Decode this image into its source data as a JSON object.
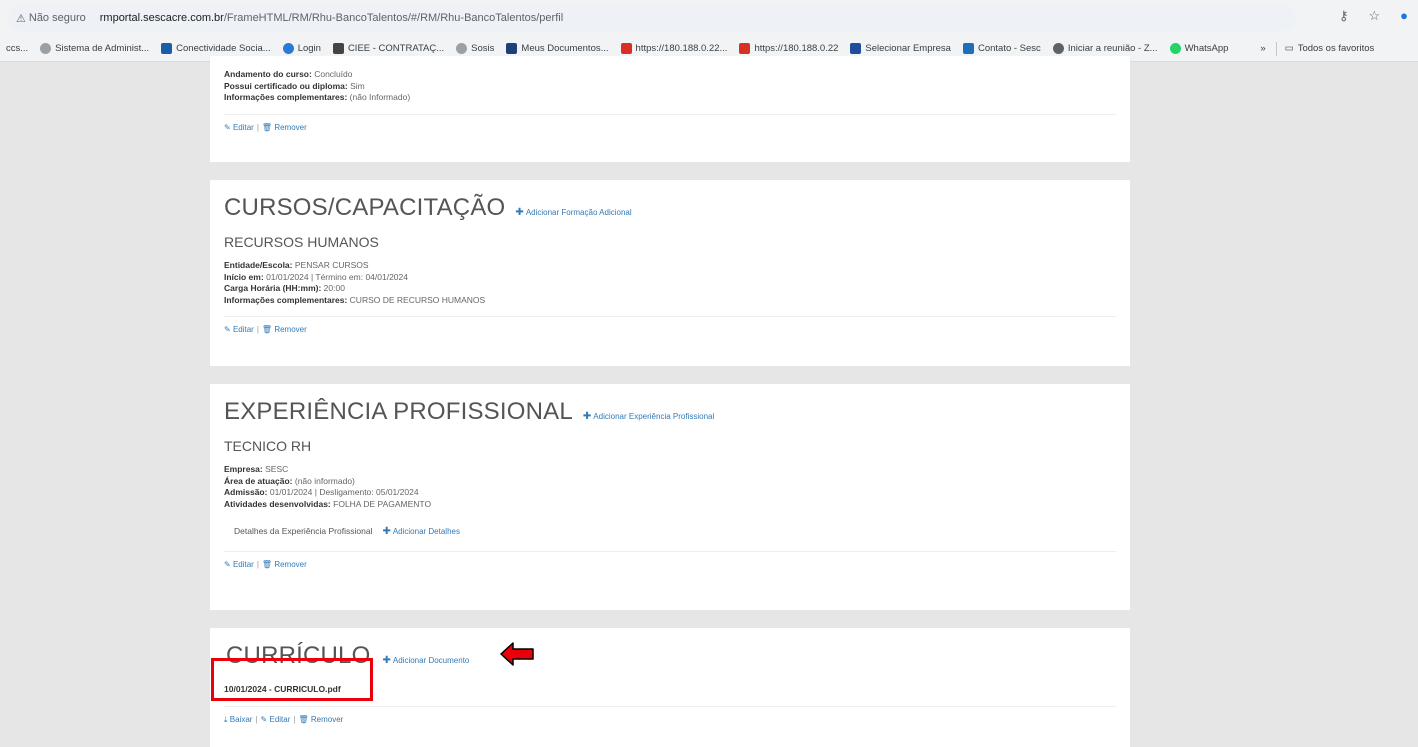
{
  "browser": {
    "not_secure": "Não seguro",
    "url_host": "rmportal.sescacre.com.br",
    "url_path": "/FrameHTML/RM/Rhu-BancoTalentos/#/RM/Rhu-BancoTalentos/perfil",
    "bookmarks": [
      {
        "label": "Sistema de Administ..."
      },
      {
        "label": "Conectividade Socia..."
      },
      {
        "label": "Login"
      },
      {
        "label": "CIEE - CONTRATAÇ..."
      },
      {
        "label": "Sosis"
      },
      {
        "label": "Meus Documentos..."
      },
      {
        "label": "https://180.188.0.22..."
      },
      {
        "label": "https://180.188.0.22"
      },
      {
        "label": "Selecionar Empresa"
      },
      {
        "label": "Contato - Sesc"
      },
      {
        "label": "Iniciar a reunião - Z..."
      },
      {
        "label": "WhatsApp"
      }
    ],
    "bookmarks_prefix": "ccs...",
    "more": "»",
    "all_favorites": "Todos os favoritos"
  },
  "top_card": {
    "fields": [
      {
        "label": "Andamento do curso:",
        "value": "Concluído"
      },
      {
        "label": "Possui certificado ou diploma:",
        "value": "Sim"
      },
      {
        "label": "Informações complementares:",
        "value": "(não Informado)"
      }
    ],
    "edit": "Editar",
    "remove": "Remover"
  },
  "courses": {
    "title": "CURSOS/CAPACITAÇÃO",
    "add_label": "Adicionar Formação Adicional",
    "item_title": "RECURSOS HUMANOS",
    "fields": [
      {
        "label": "Entidade/Escola:",
        "value": "PENSAR CURSOS"
      },
      {
        "label": "Início em:",
        "value": "01/01/2024 | Término em: 04/01/2024"
      },
      {
        "label": "Carga Horária (HH:mm):",
        "value": "20:00"
      },
      {
        "label": "Informações complementares:",
        "value": "CURSO DE RECURSO HUMANOS"
      }
    ],
    "edit": "Editar",
    "remove": "Remover"
  },
  "experience": {
    "title": "EXPERIÊNCIA PROFISSIONAL",
    "add_label": "Adicionar Experiência Profissional",
    "item_title": "TECNICO RH",
    "fields": [
      {
        "label": "Empresa:",
        "value": "SESC"
      },
      {
        "label": "Área de atuação:",
        "value": "(não informado)"
      },
      {
        "label": "Admissão:",
        "value": "01/01/2024 | Desligamento: 05/01/2024"
      },
      {
        "label": "Atividades desenvolvidas:",
        "value": "FOLHA DE PAGAMENTO"
      }
    ],
    "details_label": "Detalhes da Experiência Profissional",
    "add_details": "Adicionar Detalhes",
    "edit": "Editar",
    "remove": "Remover"
  },
  "curriculum": {
    "title": "CURRÍCULO",
    "add_label": "Adicionar Documento",
    "file": "10/01/2024 - CURRICULO.pdf",
    "download": "Baixar",
    "edit": "Editar",
    "remove": "Remover"
  },
  "colors": {
    "link": "#337ab7",
    "highlight": "#e8000b"
  }
}
